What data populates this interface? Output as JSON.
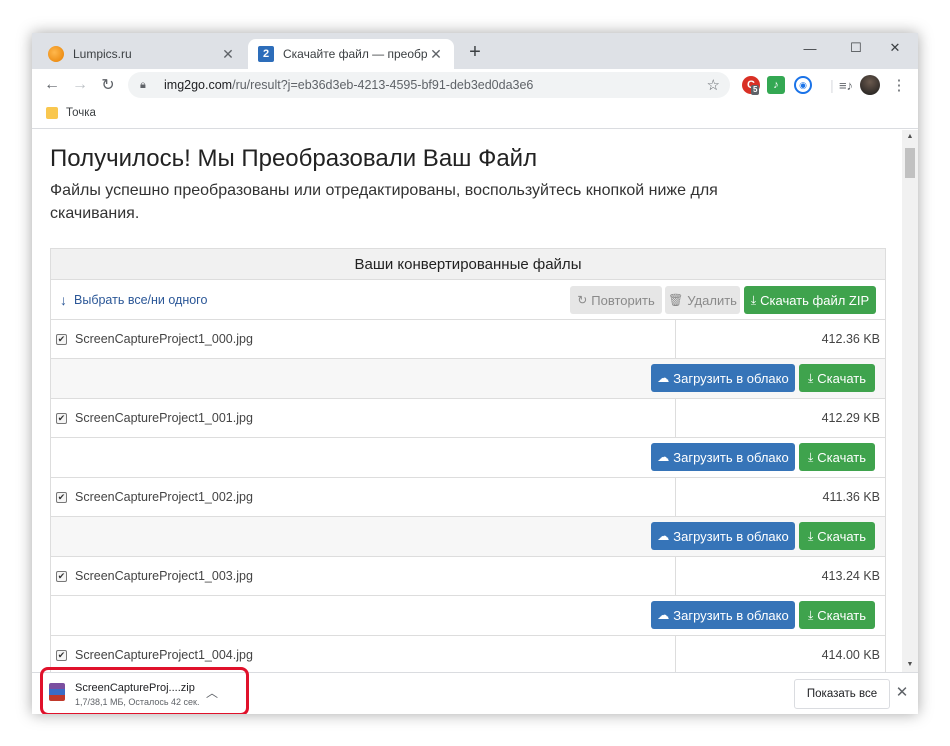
{
  "browser": {
    "tabs": [
      {
        "title": "Lumpics.ru",
        "favicon": "lumpics-orange-circle",
        "active": false
      },
      {
        "title": "Скачайте файл — преобразован",
        "favicon": "img2go-2",
        "active": true
      }
    ],
    "url_host": "img2go.com",
    "url_rest": "/ru/result?j=eb36d3eb-4213-4595-bf91-deb3ed0da3e6",
    "bookmark": "Точка",
    "extensions": [
      "extension-red-icon",
      "extension-music-icon",
      "extension-globe-icon"
    ],
    "extension_badge": "5"
  },
  "page": {
    "title": "Получилось! Мы Преобразовали Ваш Файл",
    "subtitle": "Файлы успешно преобразованы или отредактированы, воспользуйтесь кнопкой ниже для скачивания.",
    "panel_title": "Ваши конвертированные файлы",
    "select_all": "Выбрать все/ни одного",
    "retry": "Повторить",
    "delete": "Удалить",
    "download_zip": "Скачать файл ZIP",
    "upload_cloud": "Загрузить в облако",
    "download": "Скачать",
    "files": [
      {
        "name": "ScreenCaptureProject1_000.jpg",
        "size": "412.36 KB"
      },
      {
        "name": "ScreenCaptureProject1_001.jpg",
        "size": "412.29 KB"
      },
      {
        "name": "ScreenCaptureProject1_002.jpg",
        "size": "411.36 KB"
      },
      {
        "name": "ScreenCaptureProject1_003.jpg",
        "size": "413.24 KB"
      },
      {
        "name": "ScreenCaptureProject1_004.jpg",
        "size": "414.00 KB"
      }
    ]
  },
  "download_shelf": {
    "file_name": "ScreenCaptureProj....zip",
    "status": "1,7/38,1 МБ, Осталось 42 сек.",
    "show_all": "Показать все"
  },
  "colors": {
    "green_button": "#3fa34d",
    "blue_button": "#3674b8",
    "highlight_frame": "#e0112b"
  }
}
